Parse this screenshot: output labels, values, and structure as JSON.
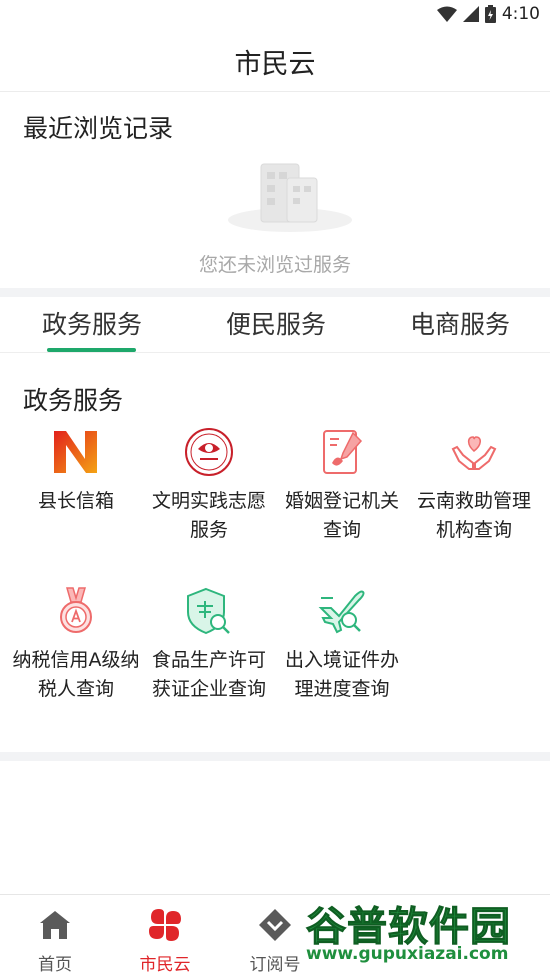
{
  "status_bar": {
    "time": "4:10"
  },
  "header": {
    "title": "市民云"
  },
  "recent": {
    "title": "最近浏览记录",
    "empty_text": "您还未浏览过服务"
  },
  "tabs": [
    {
      "label": "政务服务",
      "active": true
    },
    {
      "label": "便民服务",
      "active": false
    },
    {
      "label": "电商服务",
      "active": false
    }
  ],
  "services": {
    "title": "政务服务",
    "items": [
      {
        "label": "县长信箱",
        "icon": "county-mailbox-icon"
      },
      {
        "label": "文明实践志愿服务",
        "icon": "volunteer-emblem-icon"
      },
      {
        "label": "婚姻登记机关查询",
        "icon": "marriage-registry-icon"
      },
      {
        "label": "云南救助管理机构查询",
        "icon": "relief-hands-heart-icon"
      },
      {
        "label": "纳税信用A级纳税人查询",
        "icon": "tax-credit-medal-icon"
      },
      {
        "label": "食品生产许可获证企业查询",
        "icon": "food-license-shield-icon"
      },
      {
        "label": "出入境证件办理进度查询",
        "icon": "airplane-search-icon"
      }
    ]
  },
  "bottom_nav": [
    {
      "label": "首页",
      "icon": "home-icon",
      "active": false
    },
    {
      "label": "市民云",
      "icon": "clover-icon",
      "active": true
    },
    {
      "label": "订阅号",
      "icon": "subscribe-icon",
      "active": false
    }
  ],
  "watermark": {
    "title": "谷普软件园",
    "url": "www.gupuxiazai.com"
  },
  "colors": {
    "accent_green": "#1ea86b",
    "active_red": "#e0262a"
  }
}
